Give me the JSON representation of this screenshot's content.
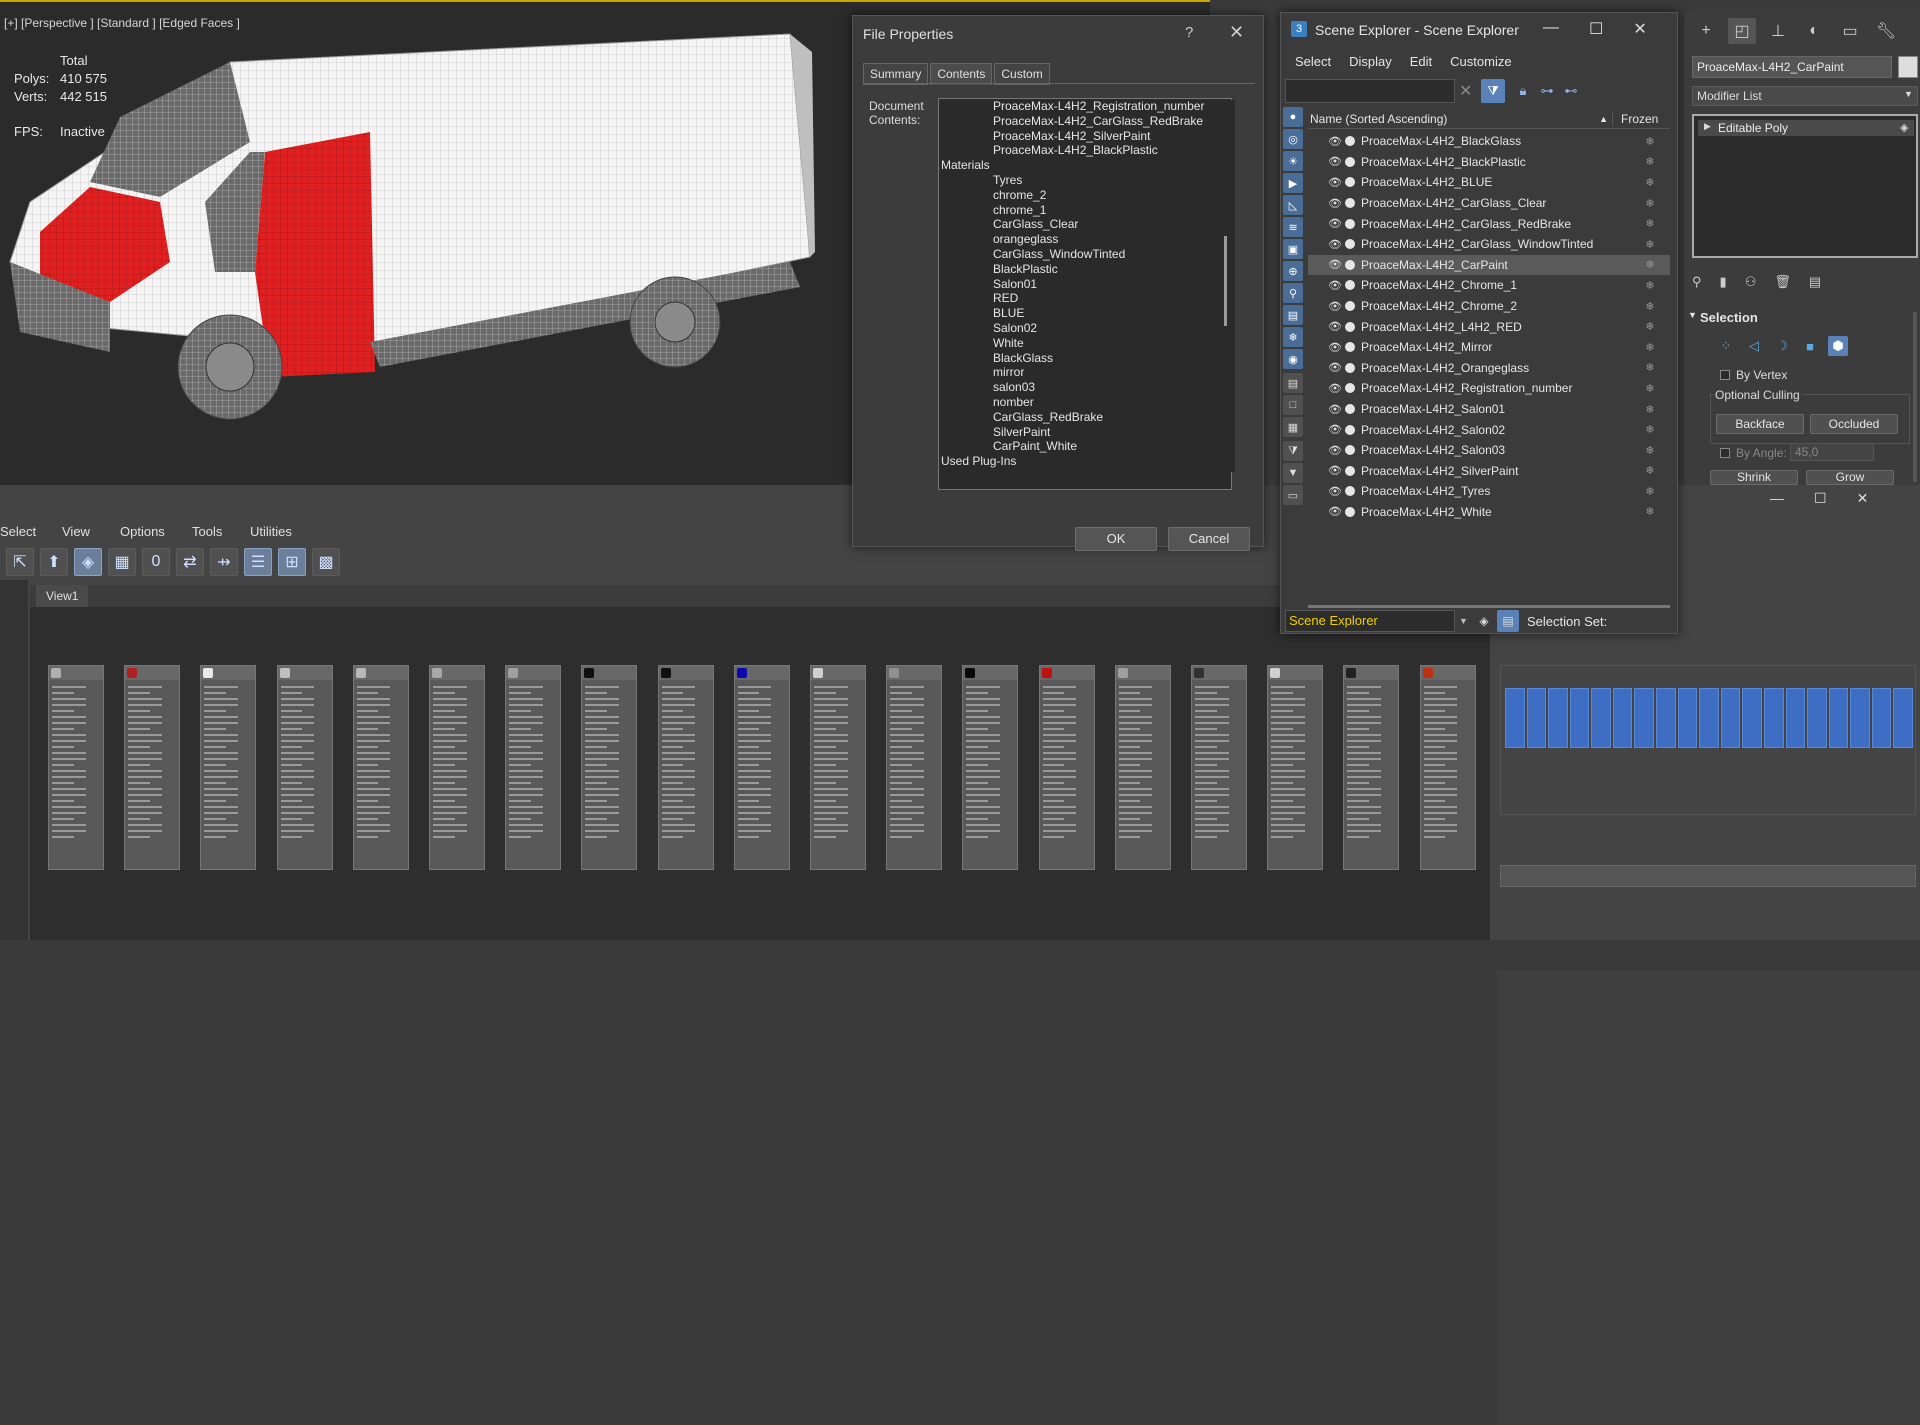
{
  "viewport": {
    "label": "[+] [Perspective ] [Standard ] [Edged Faces ]",
    "stats_header": "Total",
    "polys_label": "Polys:",
    "polys_value": "410 575",
    "verts_label": "Verts:",
    "verts_value": "442 515",
    "fps_label": "FPS:",
    "fps_value": "Inactive"
  },
  "material_editor": {
    "menu": [
      "Select",
      "View",
      "Options",
      "Tools",
      "Utilities"
    ],
    "view_tab": "View1",
    "node_colors": [
      "#b0b0b0",
      "#b02020",
      "#e8e8e8",
      "#c0c0c0",
      "#b8b8b8",
      "#a8a8a8",
      "#a0a0a0",
      "#101010",
      "#101010",
      "#0a0ab0",
      "#d0d0d0",
      "#909090",
      "#080808",
      "#c01010",
      "#a0a0a0",
      "#303030",
      "#d0d0d0",
      "#202020",
      "#c03010"
    ]
  },
  "file_properties": {
    "title": "File Properties",
    "help": "?",
    "tabs": [
      "Summary",
      "Contents",
      "Custom"
    ],
    "active_tab": "Contents",
    "doc_label": "Document Contents:",
    "objects": [
      "ProaceMax-L4H2_Registration_number",
      "ProaceMax-L4H2_CarGlass_RedBrake",
      "ProaceMax-L4H2_SilverPaint",
      "ProaceMax-L4H2_BlackPlastic"
    ],
    "materials_header": "Materials",
    "materials": [
      "Tyres",
      "chrome_2",
      "chrome_1",
      "CarGlass_Clear",
      "orangeglass",
      "CarGlass_WindowTinted",
      "BlackPlastic",
      "Salon01",
      "RED",
      "BLUE",
      "Salon02",
      "White",
      "BlackGlass",
      "mirror",
      "salon03",
      "nomber",
      "CarGlass_RedBrake",
      "SilverPaint",
      "CarPaint_White"
    ],
    "plugins_header": "Used Plug-Ins",
    "ok": "OK",
    "cancel": "Cancel"
  },
  "scene_explorer": {
    "title": "Scene Explorer - Scene Explorer",
    "menu": [
      "Select",
      "Display",
      "Edit",
      "Customize"
    ],
    "col_name": "Name (Sorted Ascending)",
    "col_frozen": "Frozen",
    "selected": "ProaceMax-L4H2_CarPaint",
    "rows": [
      "ProaceMax-L4H2_BlackGlass",
      "ProaceMax-L4H2_BlackPlastic",
      "ProaceMax-L4H2_BLUE",
      "ProaceMax-L4H2_CarGlass_Clear",
      "ProaceMax-L4H2_CarGlass_RedBrake",
      "ProaceMax-L4H2_CarGlass_WindowTinted",
      "ProaceMax-L4H2_CarPaint",
      "ProaceMax-L4H2_Chrome_1",
      "ProaceMax-L4H2_Chrome_2",
      "ProaceMax-L4H2_L4H2_RED",
      "ProaceMax-L4H2_Mirror",
      "ProaceMax-L4H2_Orangeglass",
      "ProaceMax-L4H2_Registration_number",
      "ProaceMax-L4H2_Salon01",
      "ProaceMax-L4H2_Salon02",
      "ProaceMax-L4H2_Salon03",
      "ProaceMax-L4H2_SilverPaint",
      "ProaceMax-L4H2_Tyres",
      "ProaceMax-L4H2_White"
    ],
    "dropdown": "Scene Explorer",
    "selection_set": "Selection Set:"
  },
  "command_panel": {
    "object_name": "ProaceMax-L4H2_CarPaint",
    "modifier_list": "Modifier List",
    "stack_item": "Editable Poly",
    "selection_title": "Selection",
    "by_vertex": "By Vertex",
    "optional_culling": "Optional Culling",
    "backface": "Backface",
    "occluded": "Occluded",
    "by_angle": "By Angle:",
    "angle_value": "45,0",
    "shrink": "Shrink",
    "grow": "Grow"
  }
}
